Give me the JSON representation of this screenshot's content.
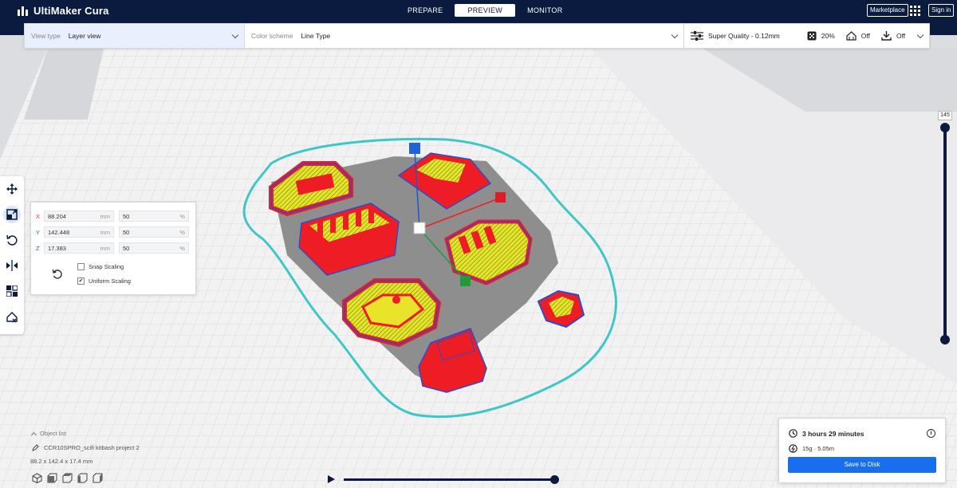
{
  "app": {
    "title": "UltiMaker Cura"
  },
  "stages": [
    "PREPARE",
    "PREVIEW",
    "MONITOR"
  ],
  "active_stage": "PREVIEW",
  "topbar": {
    "marketplace": "Marketplace",
    "signin": "Sign in"
  },
  "header": {
    "view_type_label": "View type",
    "view_type_value": "Layer view",
    "color_scheme_label": "Color scheme",
    "color_scheme_value": "Line Type",
    "profile": "Super Quality - 0.12mm",
    "infill": "20%",
    "support": "Off",
    "adhesion": "Off"
  },
  "scale_panel": {
    "x_mm": "88.204",
    "y_mm": "142.448",
    "z_mm": "17.383",
    "x_pct": "50",
    "y_pct": "50",
    "z_pct": "50",
    "unit_mm": "mm",
    "unit_pct": "%",
    "snap_label": "Snap Scaling",
    "snap_checked": false,
    "uniform_label": "Uniform Scaling",
    "uniform_checked": true,
    "check_mark": "✔"
  },
  "axes": {
    "x": "X",
    "y": "Y",
    "z": "Z"
  },
  "layer": {
    "current": "145"
  },
  "object": {
    "list_label": "Object list",
    "name": "CCR10SPRO_scifi kitbash project 2",
    "dimensions": "88.2 x 142.4 x 17.4 mm"
  },
  "estimate": {
    "time": "3 hours 29 minutes",
    "material": "15g · 5.05m",
    "info": "i",
    "save_label": "Save to Disk"
  },
  "colors": {
    "navy": "#0b1a3f",
    "accent": "#196ef0",
    "wall_red": "#ee1c24",
    "infill_yellow": "#e9e32a",
    "skirt_cyan": "#3fc7c7",
    "travel_blue": "#2a4ec9"
  }
}
